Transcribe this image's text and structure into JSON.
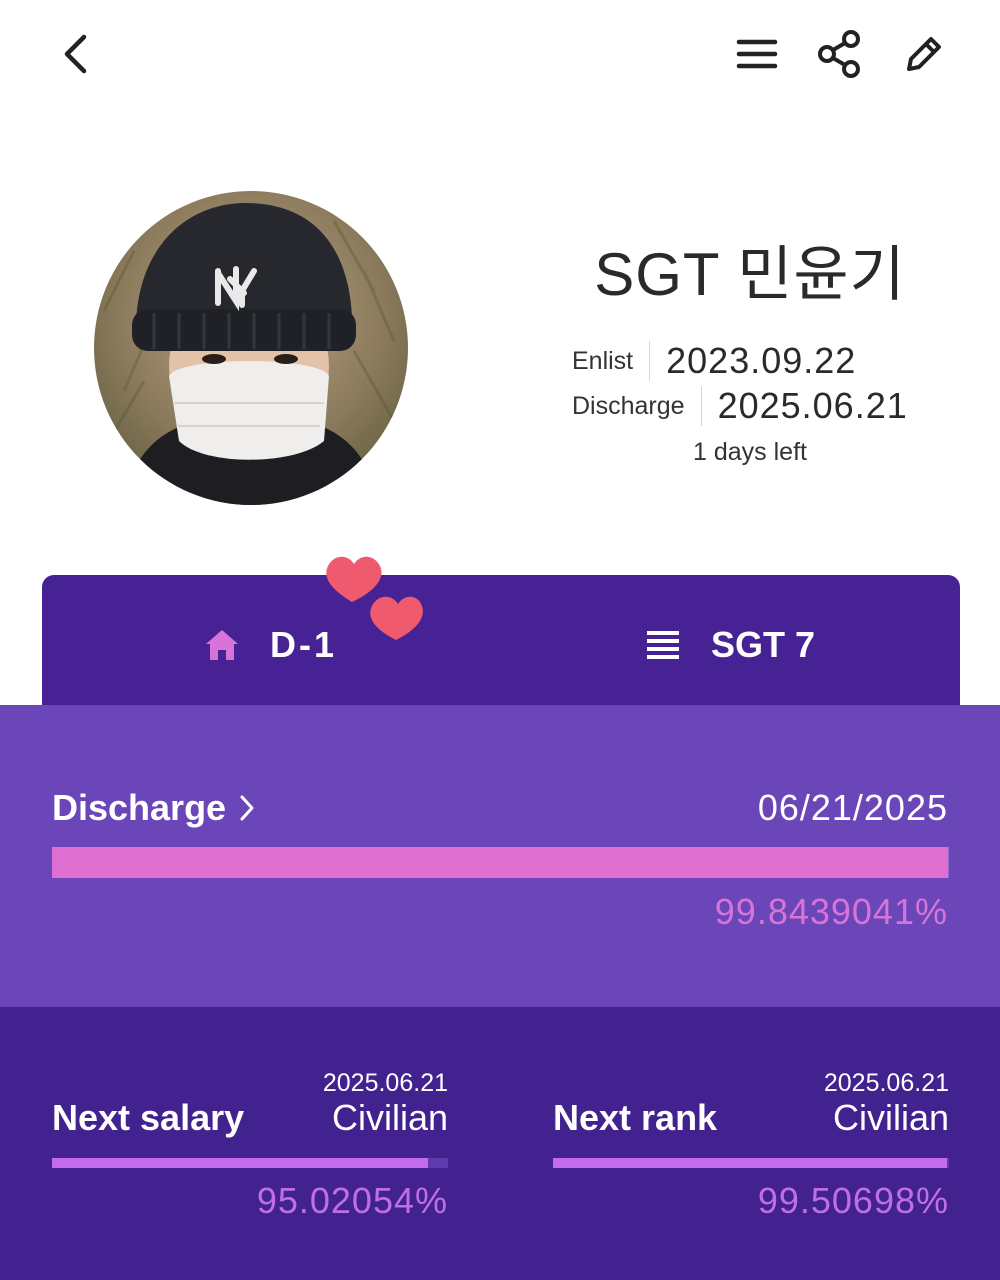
{
  "icons": {
    "back": "back-arrow-icon",
    "menu": "menu-icon",
    "share": "share-icon",
    "edit": "pencil-icon",
    "home": "home-icon",
    "list": "list-icon",
    "chevron": "chevron-right-icon",
    "hearts": "hearts-icon"
  },
  "profile": {
    "name": "SGT 민윤기",
    "enlist_label": "Enlist",
    "enlist_date": "2023.09.22",
    "discharge_label": "Discharge",
    "discharge_date": "2025.06.21",
    "days_left": "1 days left"
  },
  "tabs": {
    "dday": "D-1",
    "rank": "SGT 7"
  },
  "discharge": {
    "title": "Discharge",
    "date": "06/21/2025",
    "percent_text": "99.8439041%",
    "progress": 0.998439041
  },
  "next_salary": {
    "title": "Next salary",
    "date": "2025.06.21",
    "value": "Civilian",
    "percent_text": "95.02054%",
    "progress": 0.9502054
  },
  "next_rank": {
    "title": "Next rank",
    "date": "2025.06.21",
    "value": "Civilian",
    "percent_text": "99.50698%",
    "progress": 0.9950698
  },
  "colors": {
    "header_purple": "#472295",
    "panel_purple": "#6b46b8",
    "bottom_purple": "#41228f",
    "discharge_bar": "#e06fd2",
    "stat_bar": "#c36aee",
    "pink_text": "#d874d8",
    "heart": "#ef5a6f"
  }
}
